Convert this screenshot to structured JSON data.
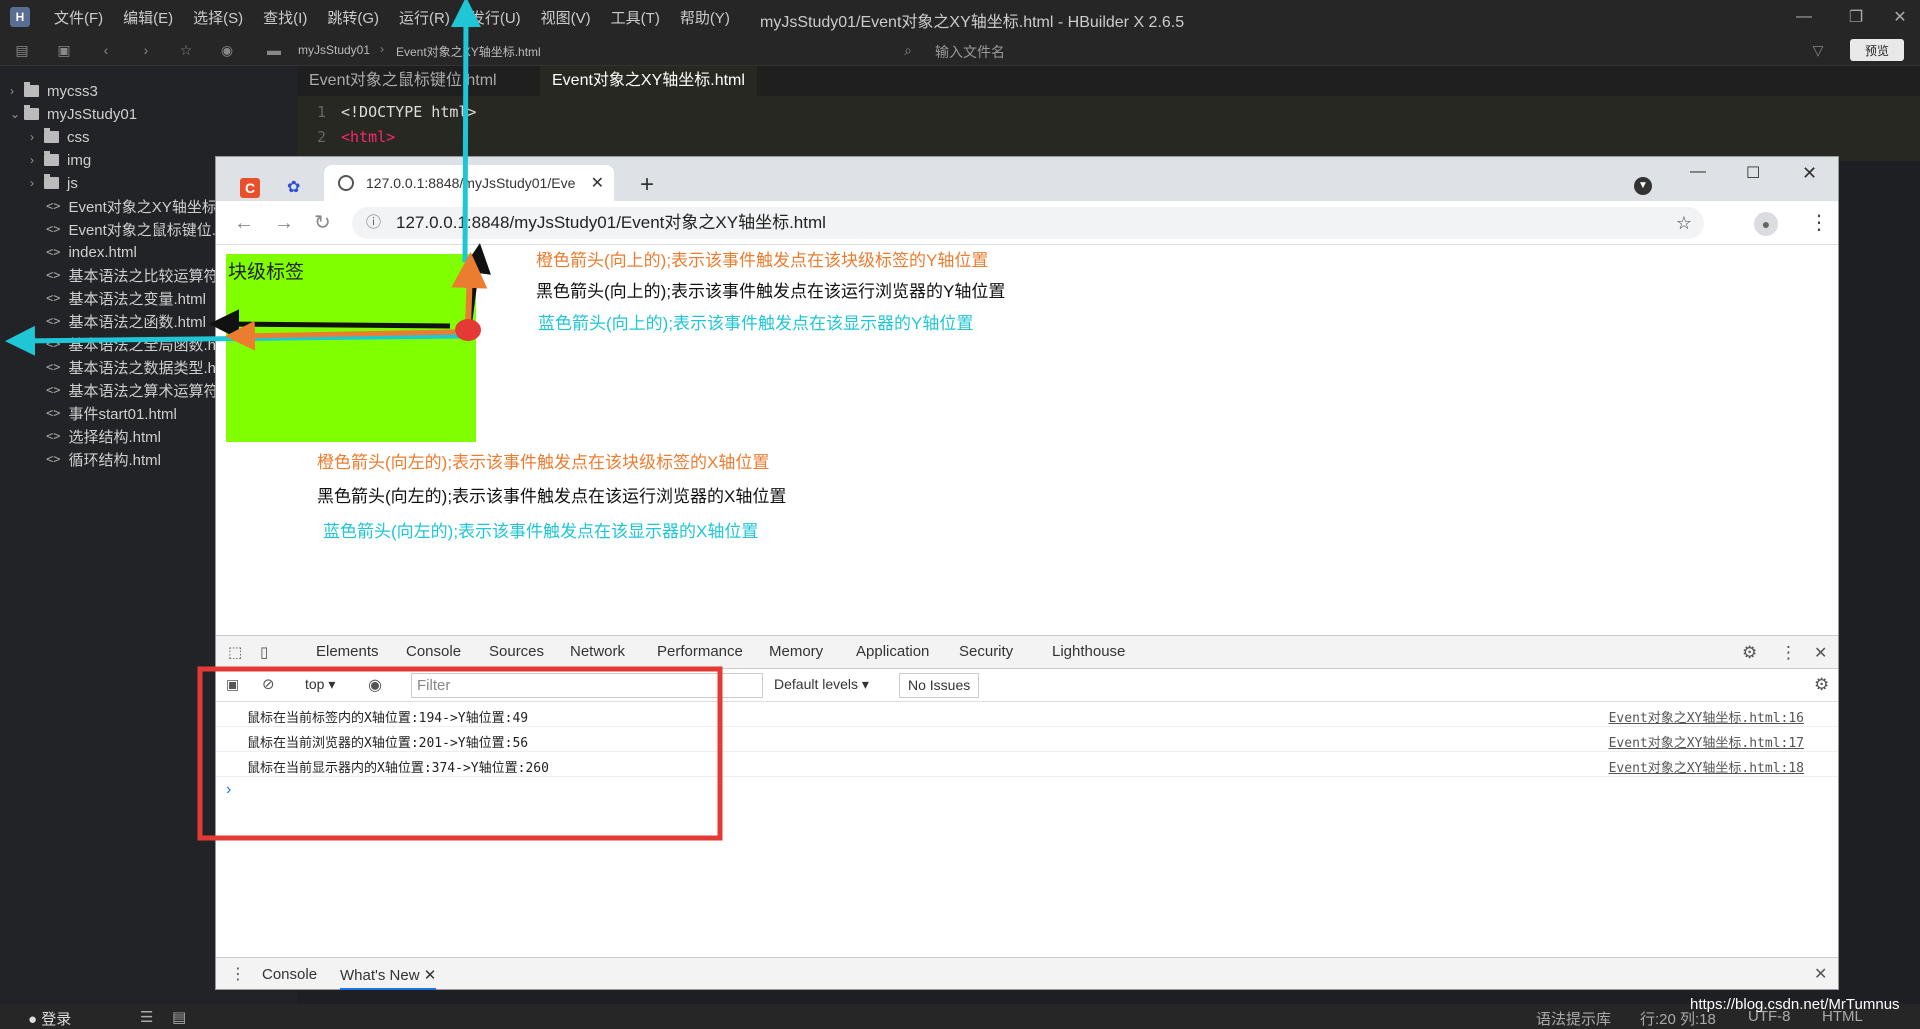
{
  "ide": {
    "menu": [
      "文件(F)",
      "编辑(E)",
      "选择(S)",
      "查找(I)",
      "跳转(G)",
      "运行(R)",
      "发行(U)",
      "视图(V)",
      "工具(T)",
      "帮助(Y)"
    ],
    "window_title": "myJsStudy01/Event对象之XY轴坐标.html - HBuilder X 2.6.5",
    "breadcrumb": [
      "myJsStudy01",
      "Event对象之XY轴坐标.html"
    ],
    "file_search_placeholder": "输入文件名",
    "preview_button": "预览",
    "tree": [
      {
        "label": "mycss3",
        "type": "folder",
        "expanded": false
      },
      {
        "label": "myJsStudy01",
        "type": "folder",
        "expanded": true
      },
      {
        "label": "css",
        "type": "folder",
        "expanded": false
      },
      {
        "label": "img",
        "type": "folder",
        "expanded": false
      },
      {
        "label": "js",
        "type": "folder",
        "expanded": false
      },
      {
        "label": "Event对象之XY轴坐标.html",
        "type": "file"
      },
      {
        "label": "Event对象之鼠标键位.html",
        "type": "file"
      },
      {
        "label": "index.html",
        "type": "file"
      },
      {
        "label": "基本语法之比较运算符.html",
        "type": "file"
      },
      {
        "label": "基本语法之变量.html",
        "type": "file"
      },
      {
        "label": "基本语法之函数.html",
        "type": "file"
      },
      {
        "label": "基本语法之全局函数.html",
        "type": "file"
      },
      {
        "label": "基本语法之数据类型.html",
        "type": "file"
      },
      {
        "label": "基本语法之算术运算符.html",
        "type": "file"
      },
      {
        "label": "事件start01.html",
        "type": "file"
      },
      {
        "label": "选择结构.html",
        "type": "file"
      },
      {
        "label": "循环结构.html",
        "type": "file"
      }
    ],
    "editor_tabs": [
      "Event对象之鼠标键位.html",
      "Event对象之XY轴坐标.html"
    ],
    "code_lines": [
      {
        "num": "1",
        "text": "<!DOCTYPE html>"
      },
      {
        "num": "2",
        "text": "<html>"
      }
    ],
    "status": {
      "login": "登录",
      "syntax": "语法提示库",
      "position": "行:20  列:18",
      "encoding": "UTF-8",
      "lang": "HTML"
    },
    "watermark": "https://blog.csdn.net/MrTumnus"
  },
  "browser": {
    "tab_title": "127.0.0.1:8848/myJsStudy01/Eve",
    "url": "127.0.0.1:8848/myJsStudy01/Event对象之XY轴坐标.html",
    "block_label": "块级标签",
    "notes": {
      "orange_up": "橙色箭头(向上的);表示该事件触发点在该块级标签的Y轴位置",
      "black_up": "黑色箭头(向上的);表示该事件触发点在该运行浏览器的Y轴位置",
      "cyan_up": "蓝色箭头(向上的);表示该事件触发点在该显示器的Y轴位置",
      "orange_left": "橙色箭头(向左的);表示该事件触发点在该块级标签的X轴位置",
      "black_left": "黑色箭头(向左的);表示该事件触发点在该运行浏览器的X轴位置",
      "cyan_left": "蓝色箭头(向左的);表示该事件触发点在该显示器的X轴位置"
    },
    "colors": {
      "orange": "#ec7c2f",
      "black": "#111111",
      "cyan": "#1fc6d6",
      "block": "#80ff00",
      "highlight": "#e53935"
    }
  },
  "devtools": {
    "tabs": [
      "Elements",
      "Console",
      "Sources",
      "Network",
      "Performance",
      "Memory",
      "Application",
      "Security",
      "Lighthouse"
    ],
    "active_tab": "Console",
    "context": "top",
    "filter_placeholder": "Filter",
    "levels": "Default levels",
    "issues": "No Issues",
    "logs": [
      {
        "msg": "鼠标在当前标签内的X轴位置:194->Y轴位置:49",
        "src": "Event对象之XY轴坐标.html:16"
      },
      {
        "msg": "鼠标在当前浏览器的X轴位置:201->Y轴位置:56",
        "src": "Event对象之XY轴坐标.html:17"
      },
      {
        "msg": "鼠标在当前显示器内的X轴位置:374->Y轴位置:260",
        "src": "Event对象之XY轴坐标.html:18"
      }
    ],
    "drawer_tabs": [
      "Console",
      "What's New"
    ]
  }
}
